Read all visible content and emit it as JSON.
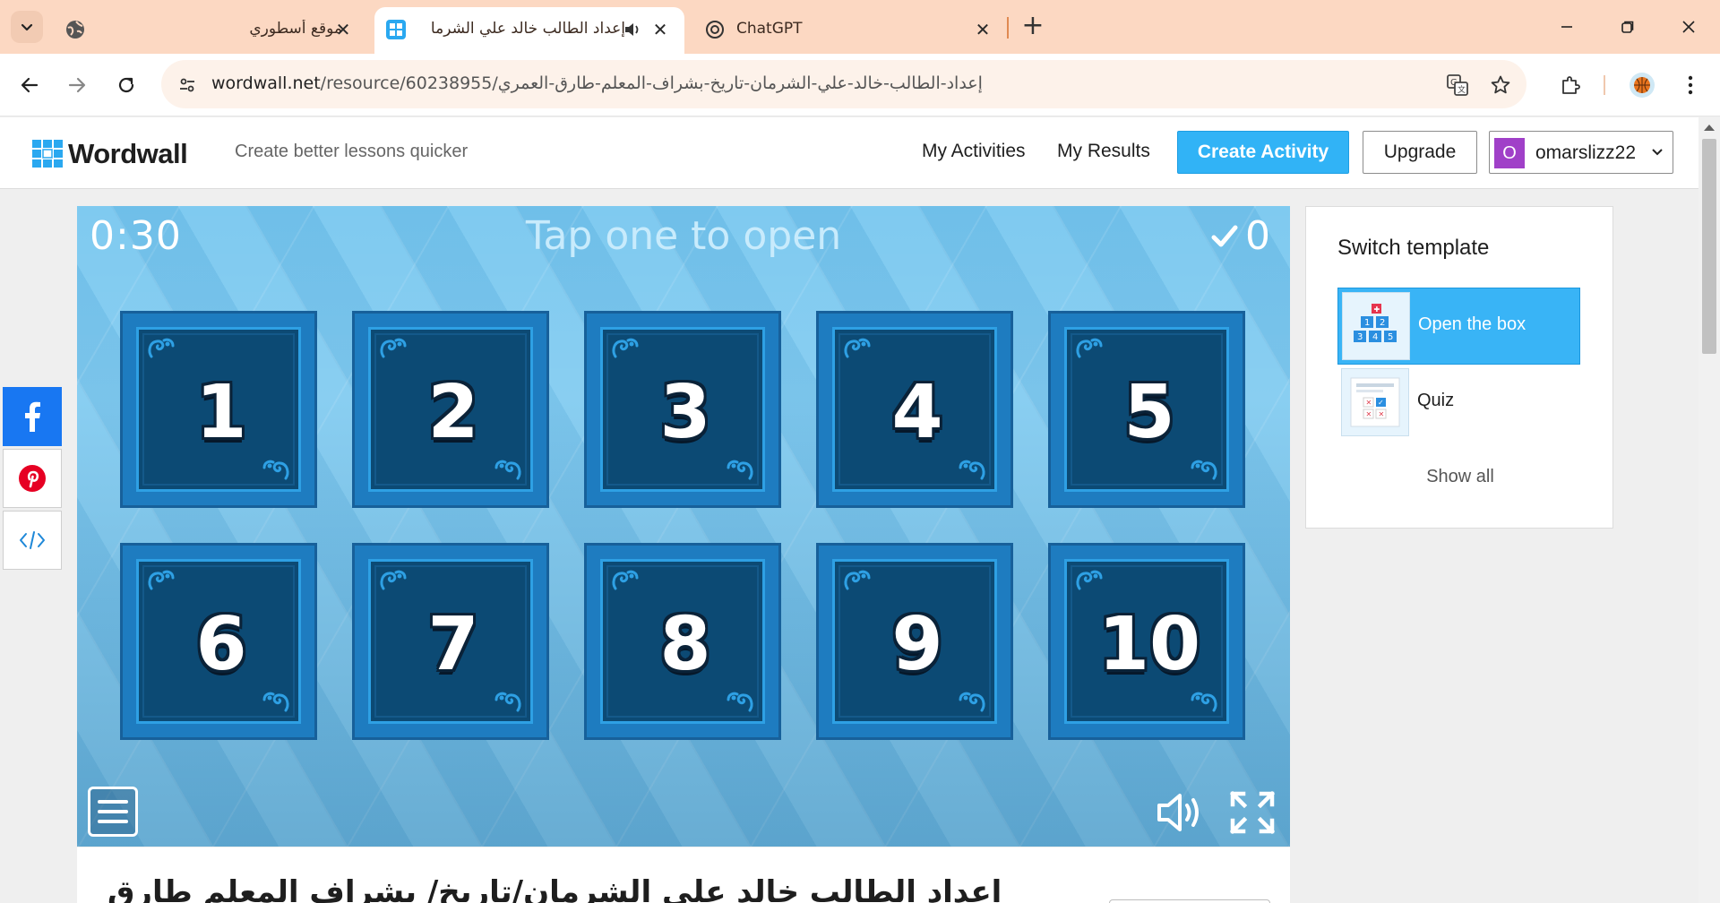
{
  "browser": {
    "tabs": [
      {
        "title": "موقع أسطوري",
        "active": false
      },
      {
        "title": "إعداد الطالب خالد علي الشرما",
        "active": true
      },
      {
        "title": "ChatGPT",
        "active": false
      }
    ],
    "url_host": "wordwall.net",
    "url_path": "/resource/60238955/إعداد-الطالب-خالد-علي-الشرمان-تاريخ-بشراف-المعلم-طارق-العمري"
  },
  "header": {
    "brand": "Wordwall",
    "tagline": "Create better lessons quicker",
    "nav": [
      "My Activities",
      "My Results"
    ],
    "create_label": "Create Activity",
    "upgrade_label": "Upgrade",
    "user_initial": "O",
    "username": "omarslizz22"
  },
  "game": {
    "timer": "0:30",
    "instruction": "Tap one to open",
    "score": "0",
    "boxes": [
      "1",
      "2",
      "3",
      "4",
      "5",
      "6",
      "7",
      "8",
      "9",
      "10"
    ]
  },
  "panel": {
    "title": "Switch template",
    "templates": [
      {
        "label": "Open the box",
        "selected": true
      },
      {
        "label": "Quiz",
        "selected": false
      }
    ],
    "show_all": "Show all"
  },
  "activity": {
    "title": "إعداد الطالب خالد علي الشرمان/تاريخ/ بشراف المعلم طارق"
  },
  "colors": {
    "tabbar": "#fcd8c2",
    "accent": "#31b3f6",
    "game_bg": "#7fcaf0",
    "box_face": "#0c4a74"
  }
}
